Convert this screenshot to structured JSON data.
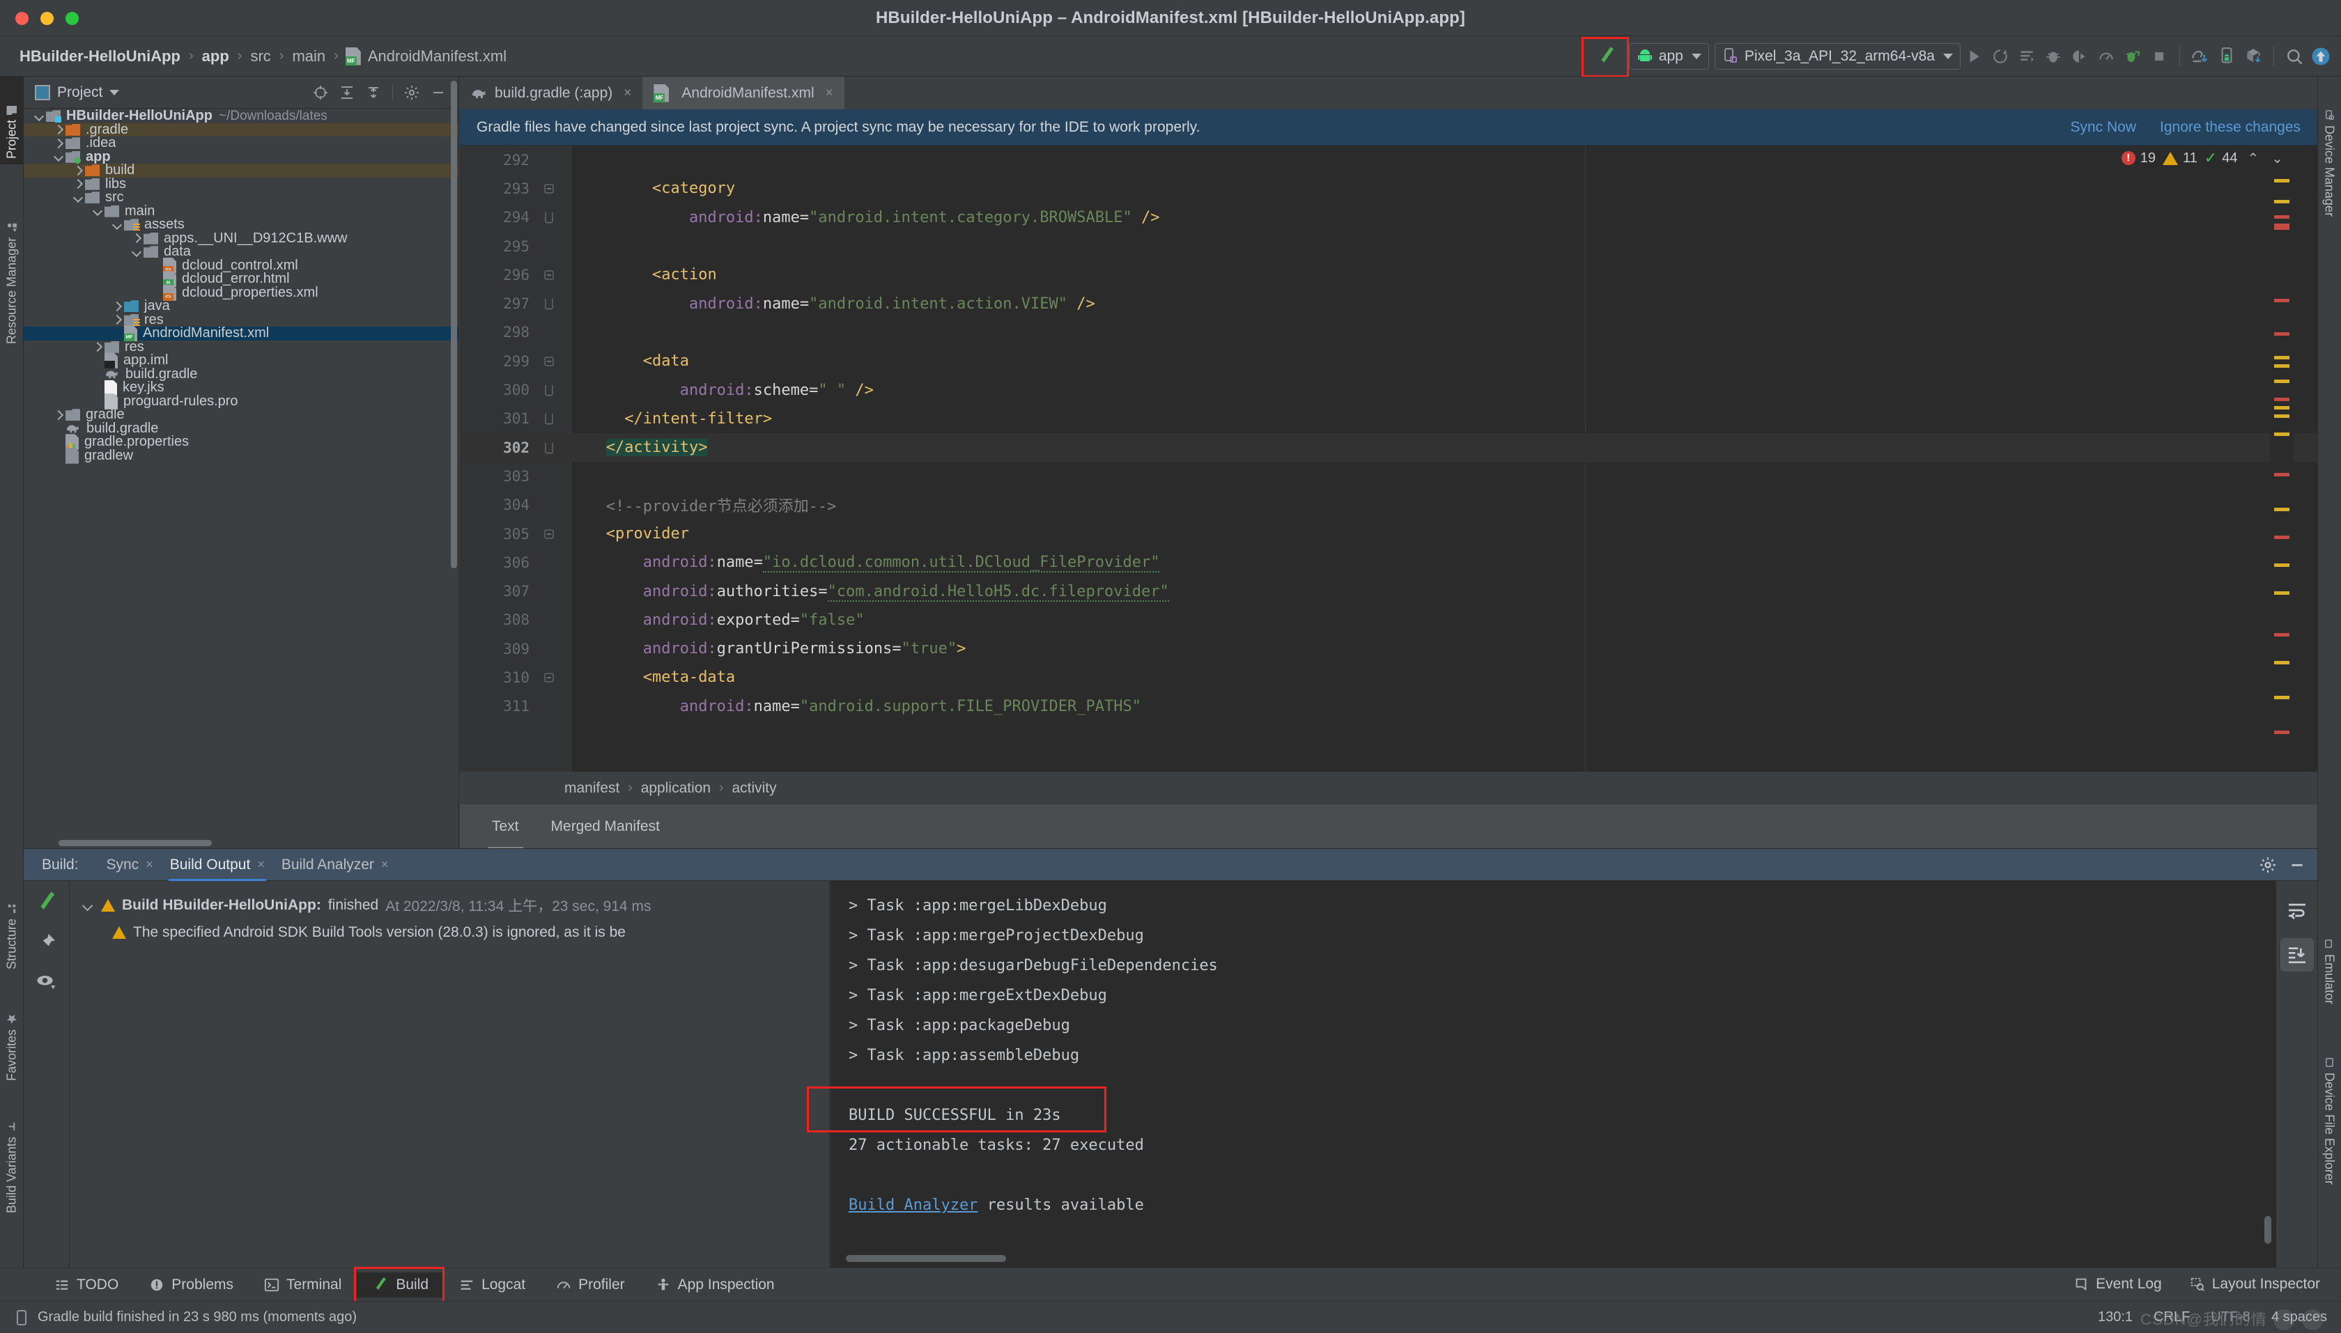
{
  "window": {
    "title": "HBuilder-HelloUniApp – AndroidManifest.xml [HBuilder-HelloUniApp.app]"
  },
  "navbar": {
    "breadcrumbs": [
      {
        "label": "HBuilder-HelloUniApp",
        "bold": true
      },
      {
        "label": "app",
        "bold": true
      },
      {
        "label": "src",
        "bold": false
      },
      {
        "label": "main",
        "bold": false
      },
      {
        "label": "AndroidManifest.xml",
        "bold": false
      }
    ],
    "build_icon": "hammer-icon",
    "app_selector": "app",
    "device_selector": "Pixel_3a_API_32_arm64-v8a",
    "actions": [
      "run-icon",
      "rerun-icon",
      "apply-changes-icon",
      "debug-icon",
      "run-coverage-icon",
      "profiler-icon",
      "attach-debugger-icon",
      "stop-icon",
      "sdk-manager-icon",
      "avd-manager-icon",
      "sync-gradle-icon",
      "search-icon",
      "update-icon"
    ]
  },
  "left_tool_tabs": [
    {
      "label": "Project",
      "active": true
    },
    {
      "label": "Resource Manager",
      "active": false
    },
    {
      "label": "Structure",
      "active": false
    },
    {
      "label": "Favorites",
      "active": false
    },
    {
      "label": "Build Variants",
      "active": false
    }
  ],
  "right_tool_tabs": [
    {
      "label": "Device Manager"
    },
    {
      "label": "Emulator"
    },
    {
      "label": "Device File Explorer"
    }
  ],
  "project_panel": {
    "title": "Project",
    "header_icons": [
      "locate-icon",
      "expand-all-icon",
      "collapse-all-icon",
      "gear-icon",
      "minimize-icon"
    ],
    "tree": [
      {
        "depth": 0,
        "arrow": "open",
        "icon": "module-folder",
        "badge": "cyan",
        "label": "HBuilder-HelloUniApp",
        "bold": true,
        "note": "~/Downloads/lates",
        "state": "normal"
      },
      {
        "depth": 1,
        "arrow": "closed",
        "icon": "folder-orange",
        "label": ".gradle",
        "state": "excluded"
      },
      {
        "depth": 1,
        "arrow": "closed",
        "icon": "folder",
        "label": ".idea",
        "state": "normal"
      },
      {
        "depth": 1,
        "arrow": "open",
        "icon": "module-folder",
        "badge": "green",
        "label": "app",
        "bold": true,
        "state": "normal"
      },
      {
        "depth": 2,
        "arrow": "closed",
        "icon": "folder-orange",
        "label": "build",
        "state": "excluded"
      },
      {
        "depth": 2,
        "arrow": "closed",
        "icon": "folder",
        "label": "libs",
        "state": "normal"
      },
      {
        "depth": 2,
        "arrow": "open",
        "icon": "folder",
        "label": "src",
        "state": "normal"
      },
      {
        "depth": 3,
        "arrow": "open",
        "icon": "folder",
        "label": "main",
        "state": "normal"
      },
      {
        "depth": 4,
        "arrow": "open",
        "icon": "folder-res",
        "label": "assets",
        "state": "normal"
      },
      {
        "depth": 5,
        "arrow": "closed",
        "icon": "folder",
        "label": "apps.__UNI__D912C1B.www",
        "state": "normal"
      },
      {
        "depth": 5,
        "arrow": "open",
        "icon": "folder",
        "label": "data",
        "state": "normal"
      },
      {
        "depth": 6,
        "arrow": "none",
        "icon": "file-xml",
        "label": "dcloud_control.xml",
        "state": "normal"
      },
      {
        "depth": 6,
        "arrow": "none",
        "icon": "file-html",
        "label": "dcloud_error.html",
        "state": "normal"
      },
      {
        "depth": 6,
        "arrow": "none",
        "icon": "file-xml",
        "label": "dcloud_properties.xml",
        "state": "normal"
      },
      {
        "depth": 4,
        "arrow": "closed",
        "icon": "folder-blue",
        "label": "java",
        "state": "normal"
      },
      {
        "depth": 4,
        "arrow": "closed",
        "icon": "folder-res",
        "label": "res",
        "state": "normal"
      },
      {
        "depth": 4,
        "arrow": "none",
        "icon": "file-mf",
        "label": "AndroidManifest.xml",
        "state": "selected"
      },
      {
        "depth": 3,
        "arrow": "closed",
        "icon": "folder",
        "label": "res",
        "state": "normal"
      },
      {
        "depth": 3,
        "arrow": "none",
        "icon": "file-iml",
        "label": "app.iml",
        "state": "normal"
      },
      {
        "depth": 3,
        "arrow": "none",
        "icon": "gradle",
        "label": "build.gradle",
        "state": "normal"
      },
      {
        "depth": 3,
        "arrow": "none",
        "icon": "file-plain",
        "label": "key.jks",
        "state": "normal"
      },
      {
        "depth": 3,
        "arrow": "none",
        "icon": "file-pro",
        "label": "proguard-rules.pro",
        "state": "normal"
      },
      {
        "depth": 1,
        "arrow": "closed",
        "icon": "folder",
        "label": "gradle",
        "state": "normal"
      },
      {
        "depth": 1,
        "arrow": "none",
        "icon": "gradle",
        "label": "build.gradle",
        "state": "normal"
      },
      {
        "depth": 1,
        "arrow": "none",
        "icon": "file-props",
        "label": "gradle.properties",
        "state": "normal"
      },
      {
        "depth": 1,
        "arrow": "none",
        "icon": "file-sh",
        "label": "gradlew",
        "state": "normal"
      }
    ]
  },
  "editor": {
    "tabs": [
      {
        "label": "build.gradle (:app)",
        "icon": "gradle-icon",
        "active": false,
        "close": "×"
      },
      {
        "label": "AndroidManifest.xml",
        "icon": "manifest-icon",
        "active": true,
        "close": "×"
      }
    ],
    "notification": {
      "message": "Gradle files have changed since last project sync. A project sync may be necessary for the IDE to work properly.",
      "links": [
        "Sync Now",
        "Ignore these changes"
      ]
    },
    "inspections": {
      "errors": "19",
      "warnings": "11",
      "ok": "44",
      "up": "⌃",
      "down": "⌄"
    },
    "first_line_number": 292,
    "current_line": 302,
    "lines": [
      {
        "n": 292,
        "fold": "",
        "segments": []
      },
      {
        "n": 293,
        "fold": "minus",
        "segments": [
          {
            "t": "plain",
            "v": "        "
          },
          {
            "t": "tag",
            "v": "<category"
          }
        ]
      },
      {
        "n": 294,
        "fold": "end",
        "segments": [
          {
            "t": "plain",
            "v": "            "
          },
          {
            "t": "attr",
            "v": "android:"
          },
          {
            "t": "attr2",
            "v": "name"
          },
          {
            "t": "eq",
            "v": "="
          },
          {
            "t": "val",
            "v": "\"android.intent.category.BROWSABLE\""
          },
          {
            "t": "plain",
            "v": " "
          },
          {
            "t": "tag",
            "v": "/>"
          }
        ]
      },
      {
        "n": 295,
        "fold": "",
        "segments": []
      },
      {
        "n": 296,
        "fold": "minus",
        "segments": [
          {
            "t": "plain",
            "v": "        "
          },
          {
            "t": "tag",
            "v": "<action"
          }
        ]
      },
      {
        "n": 297,
        "fold": "end",
        "segments": [
          {
            "t": "plain",
            "v": "            "
          },
          {
            "t": "attr",
            "v": "android:"
          },
          {
            "t": "attr2",
            "v": "name"
          },
          {
            "t": "eq",
            "v": "="
          },
          {
            "t": "val",
            "v": "\"android.intent.action.VIEW\""
          },
          {
            "t": "plain",
            "v": " "
          },
          {
            "t": "tag",
            "v": "/>"
          }
        ]
      },
      {
        "n": 298,
        "fold": "",
        "segments": []
      },
      {
        "n": 299,
        "fold": "minus",
        "segments": [
          {
            "t": "plain",
            "v": "       "
          },
          {
            "t": "tag",
            "v": "<data"
          }
        ]
      },
      {
        "n": 300,
        "fold": "end",
        "segments": [
          {
            "t": "plain",
            "v": "           "
          },
          {
            "t": "attr",
            "v": "android:"
          },
          {
            "t": "attr2",
            "v": "scheme"
          },
          {
            "t": "eq",
            "v": "="
          },
          {
            "t": "val",
            "v": "\" \""
          },
          {
            "t": "plain",
            "v": " "
          },
          {
            "t": "tag",
            "v": "/>"
          }
        ]
      },
      {
        "n": 301,
        "fold": "end",
        "segments": [
          {
            "t": "plain",
            "v": "     "
          },
          {
            "t": "tag",
            "v": "</intent-filter>"
          }
        ]
      },
      {
        "n": 302,
        "fold": "end",
        "current": true,
        "segments": [
          {
            "t": "plain",
            "v": "   "
          },
          {
            "t": "tag-sel",
            "v": "</activity>"
          }
        ]
      },
      {
        "n": 303,
        "fold": "",
        "segments": []
      },
      {
        "n": 304,
        "fold": "",
        "segments": [
          {
            "t": "plain",
            "v": "   "
          },
          {
            "t": "cmt",
            "v": "<!--provider节点必须添加-->"
          }
        ]
      },
      {
        "n": 305,
        "fold": "minus",
        "segments": [
          {
            "t": "plain",
            "v": "   "
          },
          {
            "t": "tag",
            "v": "<provider"
          }
        ]
      },
      {
        "n": 306,
        "fold": "",
        "segments": [
          {
            "t": "plain",
            "v": "       "
          },
          {
            "t": "attr",
            "v": "android:"
          },
          {
            "t": "attr2",
            "v": "name"
          },
          {
            "t": "eq",
            "v": "="
          },
          {
            "t": "val-squig",
            "v": "\"io.dcloud.common.util.DCloud_FileProvider\""
          }
        ]
      },
      {
        "n": 307,
        "fold": "",
        "segments": [
          {
            "t": "plain",
            "v": "       "
          },
          {
            "t": "attr",
            "v": "android:"
          },
          {
            "t": "attr2",
            "v": "authorities"
          },
          {
            "t": "eq",
            "v": "="
          },
          {
            "t": "val-squig",
            "v": "\"com.android.HelloH5.dc.fileprovider\""
          }
        ]
      },
      {
        "n": 308,
        "fold": "",
        "segments": [
          {
            "t": "plain",
            "v": "       "
          },
          {
            "t": "attr",
            "v": "android:"
          },
          {
            "t": "attr2",
            "v": "exported"
          },
          {
            "t": "eq",
            "v": "="
          },
          {
            "t": "val",
            "v": "\"false\""
          }
        ]
      },
      {
        "n": 309,
        "fold": "",
        "segments": [
          {
            "t": "plain",
            "v": "       "
          },
          {
            "t": "attr",
            "v": "android:"
          },
          {
            "t": "attr2",
            "v": "grantUriPermissions"
          },
          {
            "t": "eq",
            "v": "="
          },
          {
            "t": "val",
            "v": "\"true\""
          },
          {
            "t": "tag",
            "v": ">"
          }
        ]
      },
      {
        "n": 310,
        "fold": "minus",
        "segments": [
          {
            "t": "plain",
            "v": "       "
          },
          {
            "t": "tag",
            "v": "<meta-data"
          }
        ]
      },
      {
        "n": 311,
        "fold": "",
        "segments": [
          {
            "t": "plain",
            "v": "           "
          },
          {
            "t": "attr",
            "v": "android:"
          },
          {
            "t": "attr2",
            "v": "name"
          },
          {
            "t": "eq",
            "v": "="
          },
          {
            "t": "val",
            "v": "\"android.support.FILE_PROVIDER_PATHS\""
          }
        ]
      }
    ],
    "breadcrumb": [
      "manifest",
      "application",
      "activity"
    ],
    "view_tabs": [
      {
        "label": "Text",
        "active": true
      },
      {
        "label": "Merged Manifest",
        "active": false
      }
    ]
  },
  "build_panel": {
    "label": "Build:",
    "tabs": [
      {
        "label": "Sync",
        "active": false,
        "close": "×"
      },
      {
        "label": "Build Output",
        "active": true,
        "close": "×"
      },
      {
        "label": "Build Analyzer",
        "active": false,
        "close": "×"
      }
    ],
    "header_icons": [
      "gear-icon",
      "minimize-icon"
    ],
    "gutter_icons": [
      "hammer-icon",
      "pin-icon",
      "eye-icon"
    ],
    "side_icons": [
      "soft-wrap-icon",
      "scroll-to-end-icon"
    ],
    "tree": [
      {
        "indent": 0,
        "arrow": true,
        "icon": "warning",
        "bold": "Build HBuilder-HelloUniApp:",
        "text": " finished",
        "dim": "At 2022/3/8, 11:34 上午，23 sec, 914 ms"
      },
      {
        "indent": 1,
        "arrow": false,
        "icon": "warning",
        "bold": "",
        "text": "The specified Android SDK Build Tools version (28.0.3) is ignored, as it is be",
        "dim": ""
      }
    ],
    "console": [
      {
        "text": "> Task :app:mergeLibDexDebug",
        "style": "normal"
      },
      {
        "text": "> Task :app:mergeProjectDexDebug",
        "style": "normal"
      },
      {
        "text": "> Task :app:desugarDebugFileDependencies",
        "style": "normal"
      },
      {
        "text": "> Task :app:mergeExtDexDebug",
        "style": "normal"
      },
      {
        "text": "> Task :app:packageDebug",
        "style": "normal"
      },
      {
        "text": "> Task :app:assembleDebug",
        "style": "normal"
      },
      {
        "text": "",
        "style": "normal"
      },
      {
        "text": "BUILD SUCCESSFUL in 23s",
        "style": "highlight"
      },
      {
        "text": "27 actionable tasks: 27 executed",
        "style": "normal"
      },
      {
        "text": "",
        "style": "normal"
      },
      {
        "text": "Build Analyzer results available",
        "style": "link",
        "link_part": "Build Analyzer",
        "rest": " results available"
      }
    ]
  },
  "bottom_bar": [
    {
      "label": "TODO",
      "icon": "todo-icon",
      "active": false
    },
    {
      "label": "Problems",
      "icon": "problems-icon",
      "active": false
    },
    {
      "label": "Terminal",
      "icon": "terminal-icon",
      "active": false
    },
    {
      "label": "Build",
      "icon": "hammer-icon",
      "active": true
    },
    {
      "label": "Logcat",
      "icon": "logcat-icon",
      "active": false
    },
    {
      "label": "Profiler",
      "icon": "profiler-icon",
      "active": false
    },
    {
      "label": "App Inspection",
      "icon": "app-inspection-icon",
      "active": false
    }
  ],
  "status_bar": {
    "message": "Gradle build finished in 23 s 980 ms (moments ago)",
    "position": "130:1",
    "line_separator": "CRLF",
    "encoding": "UTF-8",
    "indent": "4 spaces",
    "right_tools": [
      {
        "label": "Event Log",
        "icon": "event-log-icon"
      },
      {
        "label": "Layout Inspector",
        "icon": "layout-inspector-icon"
      }
    ],
    "watermark": "CSDN@我们的情"
  },
  "colors": {
    "accent_blue": "#3d82d6",
    "link_blue": "#5b9bd5",
    "highlight_red": "#f0231f",
    "notification_bg": "#25425c",
    "panel_bg": "#3c3f41",
    "editor_bg": "#2b2b2b",
    "selection_bg": "#0d3a58"
  }
}
